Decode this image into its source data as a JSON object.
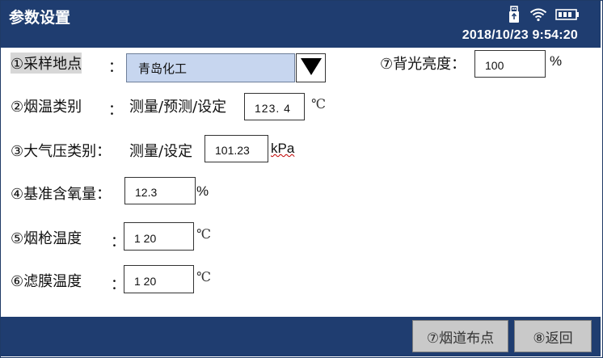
{
  "header": {
    "title": "参数设置",
    "datetime": "2018/10/23 9:54:20",
    "icons": [
      "usb-storage-icon",
      "wifi-icon",
      "battery-icon"
    ]
  },
  "form": {
    "sampling_location": {
      "label": "①采样地点",
      "colon": "：",
      "value": "青岛化工"
    },
    "backlight": {
      "label": "⑦背光亮度：",
      "value": "100",
      "unit": "%"
    },
    "flue_temp": {
      "label": "②烟温类别",
      "colon": "：",
      "mode": "测量/预测/设定",
      "value": "123. 4",
      "unit": "℃"
    },
    "atm_pressure": {
      "label": "③大气压类别：",
      "mode": "测量/设定",
      "value": "101.23",
      "unit": "kPa"
    },
    "ref_oxygen": {
      "label": "④基准含氧量：",
      "value": "12.3",
      "unit": "%"
    },
    "gun_temp": {
      "label": "⑤烟枪温度",
      "colon": "：",
      "value": "1 20",
      "unit": "℃"
    },
    "filter_temp": {
      "label": "⑥滤膜温度",
      "colon": "：",
      "value": "1 20",
      "unit": "℃"
    }
  },
  "footer": {
    "flue_layout_button": "⑦烟道布点",
    "back_button": "⑧返回"
  },
  "colors": {
    "header_bg": "#1f3d70",
    "dropdown_bg": "#c7d6ef",
    "button_bg": "#c9c9c9"
  }
}
